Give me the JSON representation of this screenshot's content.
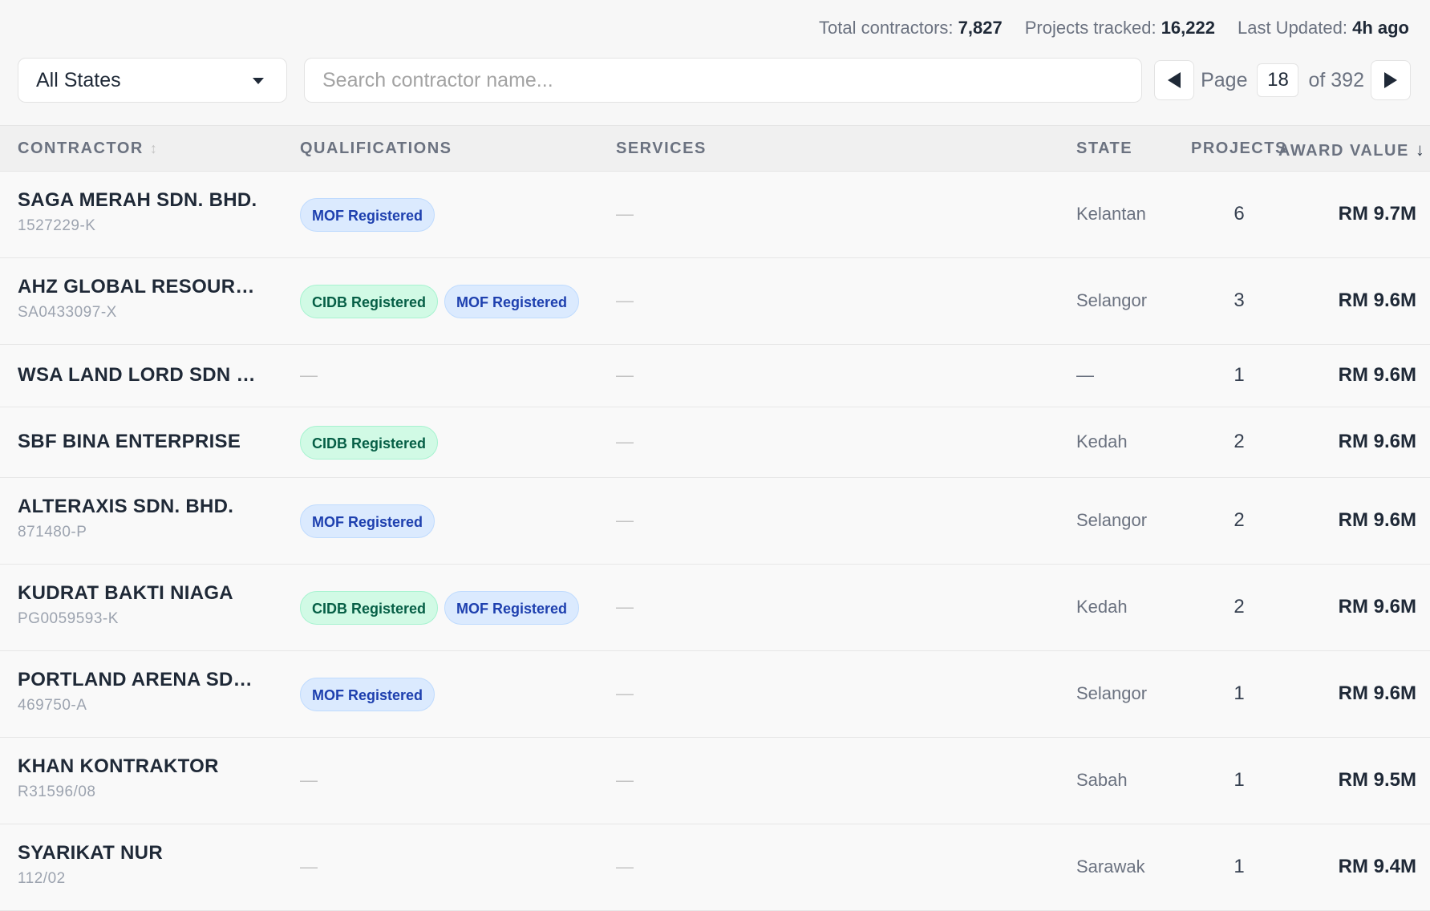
{
  "stats": {
    "total_label": "Total contractors:",
    "total_value": "7,827",
    "projects_label": "Projects tracked:",
    "projects_value": "16,222",
    "updated_label": "Last Updated:",
    "updated_value": "4h ago"
  },
  "filters": {
    "state_selected": "All States",
    "search_placeholder": "Search contractor name..."
  },
  "pager": {
    "page_label": "Page",
    "current_page": "18",
    "of_label": "of 392"
  },
  "columns": {
    "contractor": "CONTRACTOR",
    "qualifications": "QUALIFICATIONS",
    "services": "SERVICES",
    "state": "STATE",
    "projects": "PROJECTS",
    "award_value": "AWARD VALUE"
  },
  "rows": [
    {
      "name": "SAGA MERAH SDN. BHD.",
      "reg": "1527229-K",
      "quals": [
        "MOF Registered"
      ],
      "services": "—",
      "state": "Kelantan",
      "projects": "6",
      "award": "RM 9.7M"
    },
    {
      "name": "AHZ GLOBAL RESOURCES",
      "reg": "SA0433097-X",
      "quals": [
        "CIDB Registered",
        "MOF Registered"
      ],
      "services": "—",
      "state": "Selangor",
      "projects": "3",
      "award": "RM 9.6M"
    },
    {
      "name": "WSA LAND LORD SDN B...",
      "reg": "",
      "quals": [],
      "services": "—",
      "state": "—",
      "projects": "1",
      "award": "RM 9.6M"
    },
    {
      "name": "SBF BINA ENTERPRISE",
      "reg": "",
      "quals": [
        "CIDB Registered"
      ],
      "services": "—",
      "state": "Kedah",
      "projects": "2",
      "award": "RM 9.6M"
    },
    {
      "name": "ALTERAXIS SDN. BHD.",
      "reg": "871480-P",
      "quals": [
        "MOF Registered"
      ],
      "services": "—",
      "state": "Selangor",
      "projects": "2",
      "award": "RM 9.6M"
    },
    {
      "name": "KUDRAT BAKTI NIAGA",
      "reg": "PG0059593-K",
      "quals": [
        "CIDB Registered",
        "MOF Registered"
      ],
      "services": "—",
      "state": "Kedah",
      "projects": "2",
      "award": "RM 9.6M"
    },
    {
      "name": "PORTLAND ARENA SDN. ...",
      "reg": "469750-A",
      "quals": [
        "MOF Registered"
      ],
      "services": "—",
      "state": "Selangor",
      "projects": "1",
      "award": "RM 9.6M"
    },
    {
      "name": "KHAN KONTRAKTOR",
      "reg": "R31596/08",
      "quals": [],
      "services": "—",
      "state": "Sabah",
      "projects": "1",
      "award": "RM 9.5M"
    },
    {
      "name": "SYARIKAT NUR",
      "reg": "112/02",
      "quals": [],
      "services": "—",
      "state": "Sarawak",
      "projects": "1",
      "award": "RM 9.4M"
    }
  ]
}
